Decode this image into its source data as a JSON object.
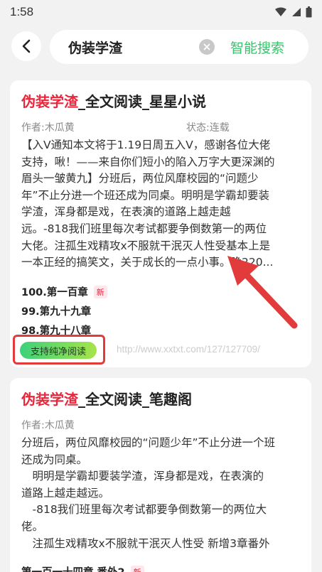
{
  "status": {
    "time": "1:58"
  },
  "search": {
    "query": "伪装学渣",
    "action_label": "智能搜索"
  },
  "results": [
    {
      "title_highlight": "伪装学渣",
      "title_rest": "_全文阅读_星星小说",
      "author": "作者:木瓜黄",
      "status": "状态:连载",
      "description_lines": [
        "【入V通知本文将于1.19日周五入V，感谢各位大佬",
        "支持，啾！——来自你们短小的陷入万字大更深渊的",
        "眉头一皱黄九】分班后，两位风靡校园的“问题少",
        "年”不止分进一个班还成为同桌。明明是学霸却要装",
        "学渣，浑身都是戏，在表演的道路上越走越",
        "远。-818我们班里每次考试都要争倒数第一的两位",
        "大佬。注孤生戏精攻x不服就干泯灭人性受基本上是",
        "一本正经的搞笑文，关于成长的一点小事。晚220..."
      ],
      "chapters": [
        {
          "label": "100.第一百章",
          "badge": "新"
        },
        {
          "label": "99.第九十九章",
          "badge": ""
        },
        {
          "label": "98.第九十八章",
          "badge": ""
        }
      ],
      "pure_read_label": "支持纯净阅读",
      "source_url": "http://www.xxtxt.com/127/127709/"
    },
    {
      "title_highlight": "伪装学渣",
      "title_rest": "_全文阅读_笔趣阁",
      "author": "作者:木瓜黄",
      "description_lines": [
        "分班后，两位风靡校园的“问题少年”不止分进一个班",
        "还成为同桌。",
        "　明明是学霸却要装学渣，浑身都是戏，在表演的",
        "道路上越走越远。",
        "　-818我们班里每次考试都要争倒数第一的两位大",
        "佬。",
        "　注孤生戏精攻x不服就干泯灭人性受 新增3章番外"
      ],
      "partial_chapter": {
        "label": "第一百一十四章 番外2",
        "badge": "新"
      }
    }
  ],
  "colors": {
    "accent_green": "#37c46a",
    "highlight_red": "#e8273c",
    "annotation_red": "#e23b3b"
  }
}
